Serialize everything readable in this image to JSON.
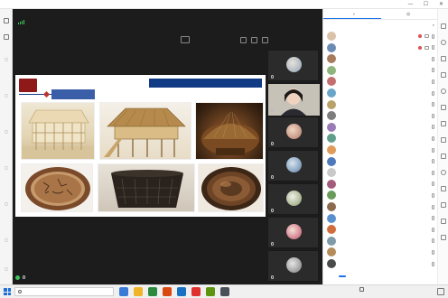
{
  "window": {
    "title": "",
    "minimize_label": "—",
    "maximize_label": "☐",
    "close_label": "✕"
  },
  "stage": {
    "signal_text": "",
    "share_title": ""
  },
  "slide": {
    "logo_text": "",
    "banner_text": "",
    "section_badge": "",
    "photos": [
      {
        "subject": "model-pavilion"
      },
      {
        "subject": "model-stilt-house"
      },
      {
        "subject": "thatched-hut"
      },
      {
        "subject": "pottery-dish"
      },
      {
        "subject": "dark-basin"
      },
      {
        "subject": "bronze-bowl"
      }
    ]
  },
  "thumbnails": [
    {
      "name": ""
    },
    {
      "name": ""
    },
    {
      "name": ""
    },
    {
      "name": ""
    },
    {
      "name": ""
    },
    {
      "name": ""
    },
    {
      "name": ""
    }
  ],
  "presenter_label": "",
  "panel": {
    "tabs": [
      {
        "label": ""
      },
      {
        "label": ""
      }
    ],
    "header": "",
    "members": [
      {
        "name": "",
        "color": "#d9c2a8"
      },
      {
        "name": "",
        "color": "#6c8bb3"
      },
      {
        "name": "",
        "color": "#a77b5e"
      },
      {
        "name": "",
        "color": "#8fb57c"
      },
      {
        "name": "",
        "color": "#c46f6f"
      },
      {
        "name": "",
        "color": "#6aa6c9"
      },
      {
        "name": "",
        "color": "#b9a16a"
      },
      {
        "name": "",
        "color": "#7d7d7d"
      },
      {
        "name": "",
        "color": "#9b7bb5"
      },
      {
        "name": "",
        "color": "#5f9e8a"
      },
      {
        "name": "",
        "color": "#e09a5a"
      },
      {
        "name": "",
        "color": "#4f79b8"
      },
      {
        "name": "",
        "color": "#c9c9c9"
      },
      {
        "name": "",
        "color": "#a45c7c"
      },
      {
        "name": "",
        "color": "#6b9b5b"
      },
      {
        "name": "",
        "color": "#8c6a4f"
      },
      {
        "name": "",
        "color": "#5a8fcf"
      },
      {
        "name": "",
        "color": "#d16d3c"
      },
      {
        "name": "",
        "color": "#7f9aa8"
      },
      {
        "name": "",
        "color": "#b58c5a"
      },
      {
        "name": "",
        "color": "#4a4a4a"
      }
    ],
    "actions": [
      {
        "label": ""
      },
      {
        "label": ""
      },
      {
        "label": ""
      }
    ]
  },
  "taskbar": {
    "search_placeholder": "",
    "tray_text": "",
    "time": "",
    "date": "",
    "watermark": ""
  }
}
